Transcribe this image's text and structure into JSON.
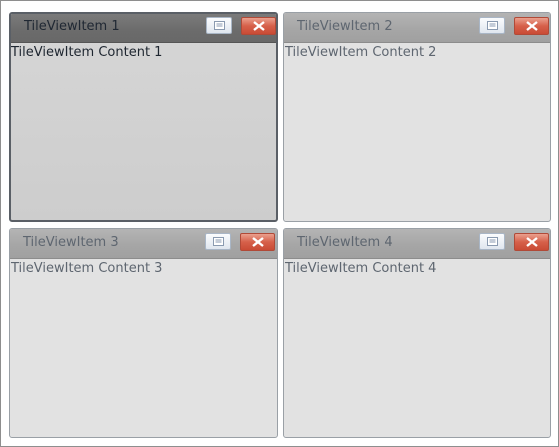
{
  "tiles": [
    {
      "title": "TileViewItem 1",
      "content": "TileViewItem Content 1",
      "active": true
    },
    {
      "title": "TileViewItem 2",
      "content": "TileViewItem Content 2",
      "active": false
    },
    {
      "title": "TileViewItem 3",
      "content": "TileViewItem Content 3",
      "active": false
    },
    {
      "title": "TileViewItem 4",
      "content": "TileViewItem Content 4",
      "active": false
    }
  ],
  "icons": {
    "maximize": "maximize-icon",
    "close": "close-icon"
  },
  "colors": {
    "active_header": "#6c6c6c",
    "inactive_header": "#a6a6a6",
    "close_button": "#d6604a",
    "tile_background": "#e2e2e2"
  }
}
